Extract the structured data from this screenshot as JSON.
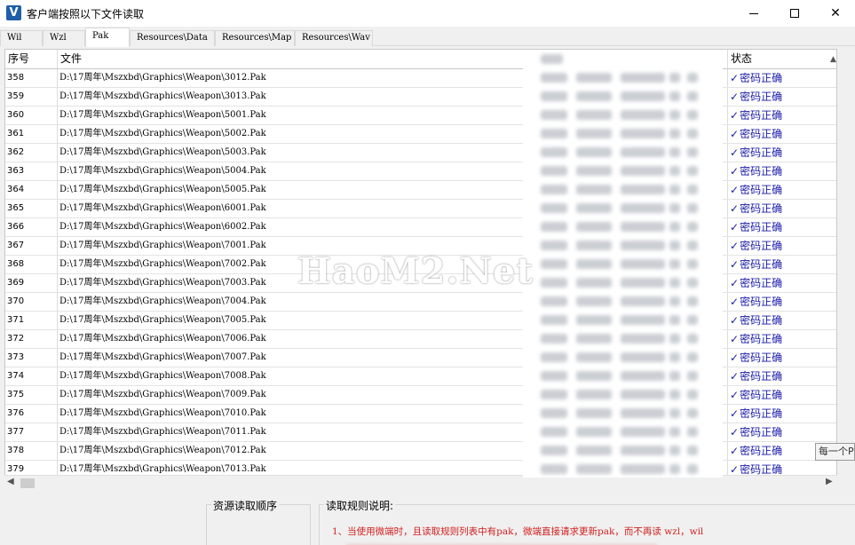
{
  "window": {
    "title": "客户端按照以下文件读取",
    "app_icon_letter": "V",
    "controls": {
      "minimize": "—",
      "maximize": "☐",
      "close": "✕"
    }
  },
  "tabs": [
    {
      "label": "Wil",
      "active": false
    },
    {
      "label": "Wzl",
      "active": false
    },
    {
      "label": "Pak",
      "active": true
    },
    {
      "label": "Resources\\Data",
      "active": false
    },
    {
      "label": "Resources\\Map",
      "active": false
    },
    {
      "label": "Resources\\Wav",
      "active": false
    }
  ],
  "table": {
    "columns": {
      "no": "序号",
      "file": "文件",
      "status": "状态"
    },
    "status_check": "✓",
    "rows": [
      {
        "no": "358",
        "file": "D:\\17周年\\Mszxbd\\Graphics\\Weapon\\3012.Pak",
        "status": "密码正确"
      },
      {
        "no": "359",
        "file": "D:\\17周年\\Mszxbd\\Graphics\\Weapon\\3013.Pak",
        "status": "密码正确"
      },
      {
        "no": "360",
        "file": "D:\\17周年\\Mszxbd\\Graphics\\Weapon\\5001.Pak",
        "status": "密码正确"
      },
      {
        "no": "361",
        "file": "D:\\17周年\\Mszxbd\\Graphics\\Weapon\\5002.Pak",
        "status": "密码正确"
      },
      {
        "no": "362",
        "file": "D:\\17周年\\Mszxbd\\Graphics\\Weapon\\5003.Pak",
        "status": "密码正确"
      },
      {
        "no": "363",
        "file": "D:\\17周年\\Mszxbd\\Graphics\\Weapon\\5004.Pak",
        "status": "密码正确"
      },
      {
        "no": "364",
        "file": "D:\\17周年\\Mszxbd\\Graphics\\Weapon\\5005.Pak",
        "status": "密码正确"
      },
      {
        "no": "365",
        "file": "D:\\17周年\\Mszxbd\\Graphics\\Weapon\\6001.Pak",
        "status": "密码正确"
      },
      {
        "no": "366",
        "file": "D:\\17周年\\Mszxbd\\Graphics\\Weapon\\6002.Pak",
        "status": "密码正确"
      },
      {
        "no": "367",
        "file": "D:\\17周年\\Mszxbd\\Graphics\\Weapon\\7001.Pak",
        "status": "密码正确"
      },
      {
        "no": "368",
        "file": "D:\\17周年\\Mszxbd\\Graphics\\Weapon\\7002.Pak",
        "status": "密码正确"
      },
      {
        "no": "369",
        "file": "D:\\17周年\\Mszxbd\\Graphics\\Weapon\\7003.Pak",
        "status": "密码正确"
      },
      {
        "no": "370",
        "file": "D:\\17周年\\Mszxbd\\Graphics\\Weapon\\7004.Pak",
        "status": "密码正确"
      },
      {
        "no": "371",
        "file": "D:\\17周年\\Mszxbd\\Graphics\\Weapon\\7005.Pak",
        "status": "密码正确"
      },
      {
        "no": "372",
        "file": "D:\\17周年\\Mszxbd\\Graphics\\Weapon\\7006.Pak",
        "status": "密码正确"
      },
      {
        "no": "373",
        "file": "D:\\17周年\\Mszxbd\\Graphics\\Weapon\\7007.Pak",
        "status": "密码正确"
      },
      {
        "no": "374",
        "file": "D:\\17周年\\Mszxbd\\Graphics\\Weapon\\7008.Pak",
        "status": "密码正确"
      },
      {
        "no": "375",
        "file": "D:\\17周年\\Mszxbd\\Graphics\\Weapon\\7009.Pak",
        "status": "密码正确"
      },
      {
        "no": "376",
        "file": "D:\\17周年\\Mszxbd\\Graphics\\Weapon\\7010.Pak",
        "status": "密码正确"
      },
      {
        "no": "377",
        "file": "D:\\17周年\\Mszxbd\\Graphics\\Weapon\\7011.Pak",
        "status": "密码正确"
      },
      {
        "no": "378",
        "file": "D:\\17周年\\Mszxbd\\Graphics\\Weapon\\7012.Pak",
        "status": "密码正确"
      },
      {
        "no": "379",
        "file": "D:\\17周年\\Mszxbd\\Graphics\\Weapon\\7013.Pak",
        "status": "密码正确"
      }
    ]
  },
  "tooltip": "每一个P",
  "watermark": "HaoM2.Net",
  "bottom": {
    "order_label": "资源读取顺序",
    "rules_label": "读取规则说明:",
    "rules": [
      "1、当使用微端时，且读取规则列表中有pak，微端直接请求更新pak，而不再读 wzl，wil"
    ]
  },
  "colors": {
    "status_text": "#1a1aaa",
    "rule_text": "#d21e1e",
    "app_icon": "#1e5fa8"
  }
}
